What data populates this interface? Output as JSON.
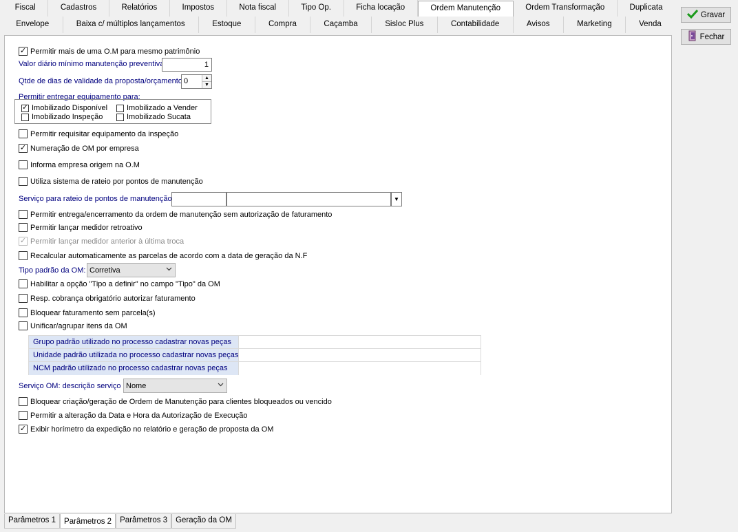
{
  "tabs_row1": [
    {
      "label": "Fiscal",
      "active": false
    },
    {
      "label": "Cadastros",
      "active": false
    },
    {
      "label": "Relatórios",
      "active": false
    },
    {
      "label": "Impostos",
      "active": false
    },
    {
      "label": "Nota fiscal",
      "active": false
    },
    {
      "label": "Tipo Op.",
      "active": false
    },
    {
      "label": "Ficha locação",
      "active": false
    },
    {
      "label": "Ordem Manutenção",
      "active": true
    },
    {
      "label": "Ordem Transformação",
      "active": false
    },
    {
      "label": "Duplicata",
      "active": false
    }
  ],
  "tabs_row2": [
    {
      "label": "Envelope"
    },
    {
      "label": "Baixa c/ múltiplos lançamentos"
    },
    {
      "label": "Estoque"
    },
    {
      "label": "Compra"
    },
    {
      "label": "Caçamba"
    },
    {
      "label": "Sisloc Plus"
    },
    {
      "label": "Contabilidade"
    },
    {
      "label": "Avisos"
    },
    {
      "label": "Marketing"
    },
    {
      "label": "Venda"
    }
  ],
  "buttons": {
    "save": "Gravar",
    "close": "Fechar"
  },
  "options": {
    "multi_om": {
      "label": "Permitir mais de uma O.M para mesmo patrimônio",
      "checked": true
    },
    "min_daily_label": "Valor diário mínimo manutenção preventiva",
    "min_daily_value": "1",
    "validity_label": "Qtde de dias de validade da proposta/orçamento",
    "validity_value": "0",
    "deliver_label": "Permitir entregar equipamento para:",
    "deliver_items": [
      {
        "label": "Imobilizado Disponível",
        "checked": true
      },
      {
        "label": "Imobilizado a Vender",
        "checked": false
      },
      {
        "label": "Imobilizado Inspeção",
        "checked": false
      },
      {
        "label": "Imobilizado Sucata",
        "checked": false
      }
    ],
    "req_inspection": {
      "label": "Permitir requisitar equipamento da inspeção",
      "checked": false
    },
    "om_per_company": {
      "label": "Numeração de OM por empresa",
      "checked": true
    },
    "origin_company": {
      "label": "Informa empresa origem na O.M",
      "checked": false
    },
    "rateio_system": {
      "label": "Utiliza sistema de rateio por pontos de manutenção",
      "checked": false
    },
    "rateio_service_label": "Serviço para rateio de pontos de manutenção",
    "delivery_no_auth": {
      "label": "Permitir entrega/encerramento da ordem de manutenção sem autorização de faturamento",
      "checked": false
    },
    "retro_meter": {
      "label": "Permitir lançar medidor retroativo",
      "checked": false
    },
    "prev_meter": {
      "label": "Permitir lançar medidor anterior à última troca",
      "checked": true,
      "disabled": true
    },
    "recalc_installments": {
      "label": "Recalcular automaticamente as parcelas de acordo com a data de geração da N.F",
      "checked": false
    },
    "om_type_label": "Tipo padrão da OM:",
    "om_type_value": "Corretiva",
    "type_to_define": {
      "label": "Habilitar a opção \"Tipo a definir\" no campo \"Tipo\" da OM",
      "checked": false
    },
    "resp_billing": {
      "label": "Resp. cobrança obrigatório autorizar faturamento",
      "checked": false
    },
    "block_no_installment": {
      "label": "Bloquear faturamento sem parcela(s)",
      "checked": false
    },
    "unify_items": {
      "label": "Unificar/agrupar itens da OM",
      "checked": false
    },
    "parts_grid": [
      {
        "label": "Grupo padrão utilizado no processo cadastrar novas peças",
        "value": ""
      },
      {
        "label": "Unidade padrão utilizada no processo cadastrar novas peças",
        "value": ""
      },
      {
        "label": "NCM padrão utilizado no processo cadastrar novas peças",
        "value": ""
      }
    ],
    "service_desc_label": "Serviço OM: descrição serviço",
    "service_desc_value": "Nome",
    "block_blocked_clients": {
      "label": "Bloquear criação/geração de Ordem de Manutenção para clientes bloqueados ou vencido",
      "checked": false
    },
    "alter_auth_date": {
      "label": "Permitir a alteração da Data e Hora da Autorização de Execução",
      "checked": false
    },
    "show_hourmeter": {
      "label": "Exibir horímetro da expedição no relatório e geração de proposta da OM",
      "checked": true
    }
  },
  "bottom_tabs": [
    {
      "label": "Parâmetros 1",
      "active": false
    },
    {
      "label": "Parâmetros 2",
      "active": true
    },
    {
      "label": "Parâmetros 3",
      "active": false
    },
    {
      "label": "Geração da OM",
      "active": false
    }
  ],
  "icons": {
    "save": "checkmark-icon",
    "close": "exit-door-icon",
    "dropdown": "chevron-down-icon"
  },
  "colors": {
    "label_blue": "#00007f",
    "grid_label_bg": "#dde6f5",
    "save_check": "#1a9a1a"
  }
}
